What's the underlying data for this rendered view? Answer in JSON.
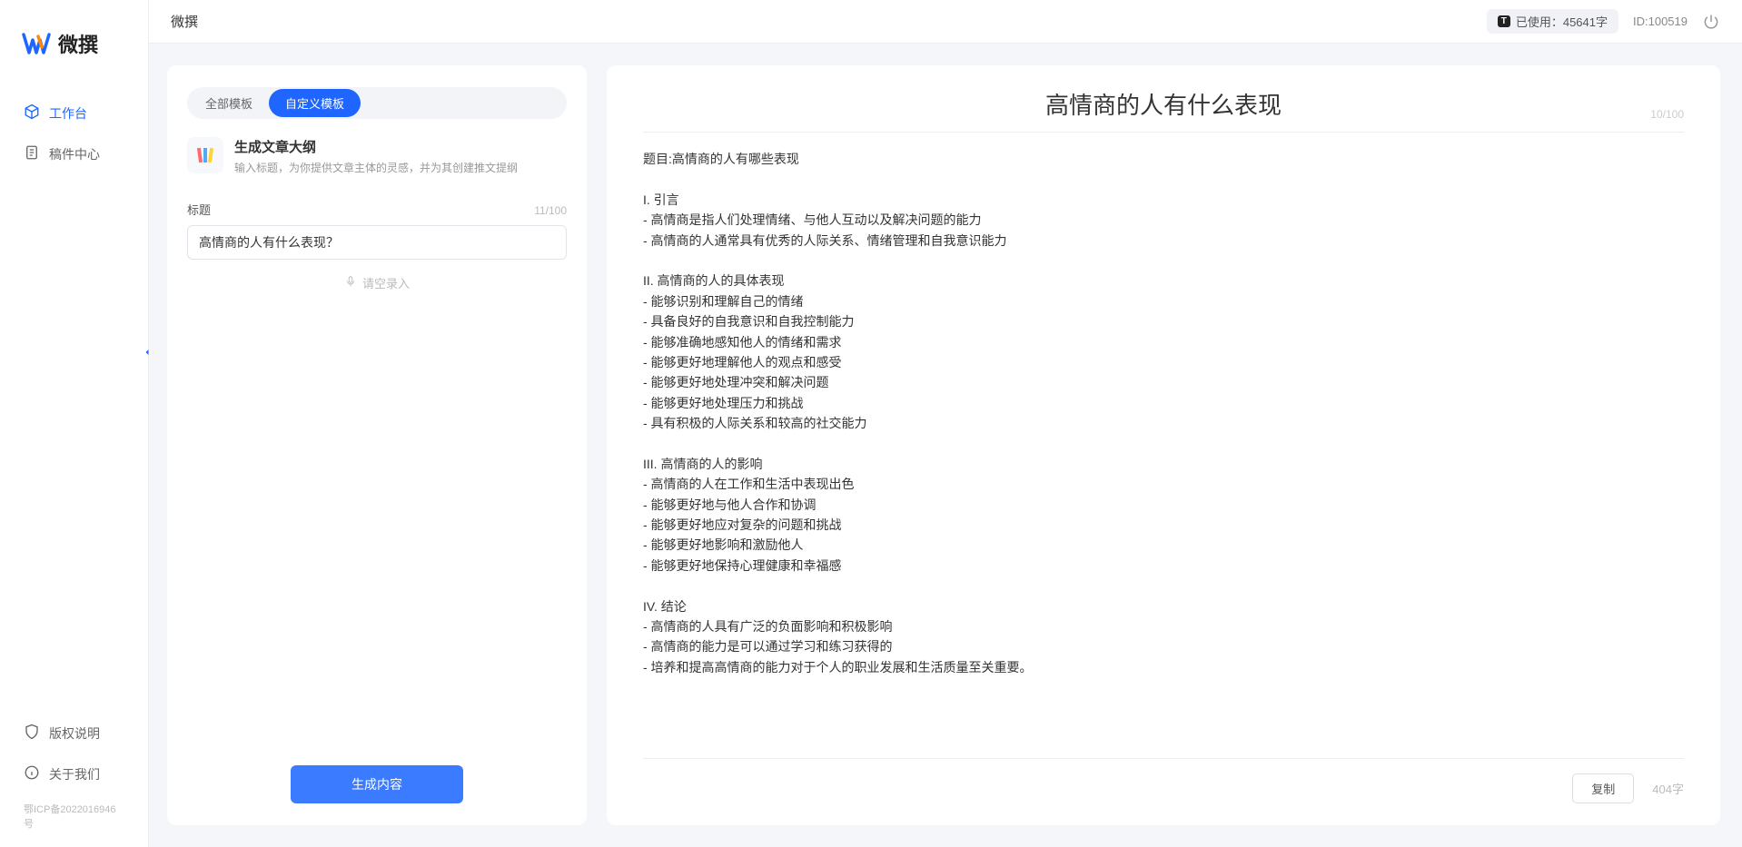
{
  "app": {
    "name": "微撰",
    "logoColors": {
      "blue": "#1e66ff",
      "orange": "#ff8a00"
    }
  },
  "sidebar": {
    "items": [
      {
        "icon": "cube",
        "label": "工作台",
        "active": true
      },
      {
        "icon": "doc",
        "label": "稿件中心",
        "active": false
      }
    ],
    "bottom": [
      {
        "icon": "shield",
        "label": "版权说明"
      },
      {
        "icon": "info",
        "label": "关于我们"
      }
    ],
    "icp": "鄂ICP备2022016946号"
  },
  "topbar": {
    "title": "微撰",
    "usage_badge": "T",
    "usage_label": "已使用：45641字",
    "id_label": "ID:100519"
  },
  "left": {
    "tabs": [
      {
        "label": "全部模板",
        "active": false
      },
      {
        "label": "自定义模板",
        "active": true
      }
    ],
    "card": {
      "title": "生成文章大纲",
      "desc": "输入标题，为你提供文章主体的灵感，并为其创建推文提纲"
    },
    "field_label": "标题",
    "char_count": "11/100",
    "input_value": "高情商的人有什么表现？",
    "voice_hint": "请空录入",
    "generate_btn": "生成内容"
  },
  "right": {
    "title": "高情商的人有什么表现",
    "title_count": "10/100",
    "body": "题目:高情商的人有哪些表现\n\nI. 引言\n- 高情商是指人们处理情绪、与他人互动以及解决问题的能力\n- 高情商的人通常具有优秀的人际关系、情绪管理和自我意识能力\n\nII. 高情商的人的具体表现\n- 能够识别和理解自己的情绪\n- 具备良好的自我意识和自我控制能力\n- 能够准确地感知他人的情绪和需求\n- 能够更好地理解他人的观点和感受\n- 能够更好地处理冲突和解决问题\n- 能够更好地处理压力和挑战\n- 具有积极的人际关系和较高的社交能力\n\nIII. 高情商的人的影响\n- 高情商的人在工作和生活中表现出色\n- 能够更好地与他人合作和协调\n- 能够更好地应对复杂的问题和挑战\n- 能够更好地影响和激励他人\n- 能够更好地保持心理健康和幸福感\n\nIV. 结论\n- 高情商的人具有广泛的负面影响和积极影响\n- 高情商的能力是可以通过学习和练习获得的\n- 培养和提高高情商的能力对于个人的职业发展和生活质量至关重要。",
    "copy_btn": "复制",
    "word_count": "404字"
  }
}
